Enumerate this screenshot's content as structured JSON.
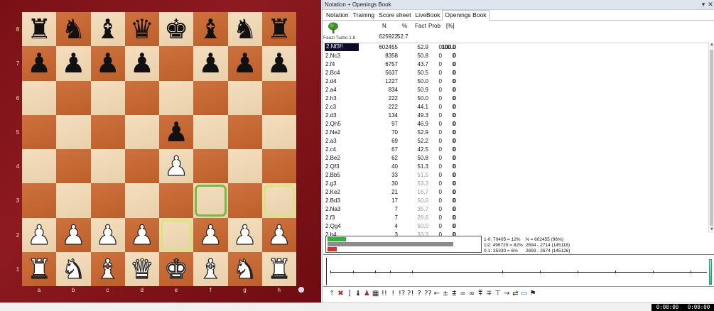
{
  "board": {
    "files": [
      "a",
      "b",
      "c",
      "d",
      "e",
      "f",
      "g",
      "h"
    ],
    "ranks": [
      "8",
      "7",
      "6",
      "5",
      "4",
      "3",
      "2",
      "1"
    ],
    "position": [
      [
        "br",
        "bn",
        "bb",
        "bq",
        "bk",
        "bb",
        "bn",
        "br"
      ],
      [
        "bp",
        "bp",
        "bp",
        "bp",
        "",
        "bp",
        "bp",
        "bp"
      ],
      [
        "",
        "",
        "",
        "",
        "",
        "",
        "",
        ""
      ],
      [
        "",
        "",
        "",
        "",
        "bp",
        "",
        "",
        ""
      ],
      [
        "",
        "",
        "",
        "",
        "wp",
        "",
        "",
        ""
      ],
      [
        "",
        "",
        "",
        "",
        "",
        "",
        "",
        ""
      ],
      [
        "wp",
        "wp",
        "wp",
        "wp",
        "",
        "wp",
        "wp",
        "wp"
      ],
      [
        "wr",
        "wn",
        "wb",
        "wq",
        "wk",
        "wb",
        "wn",
        "wr"
      ]
    ],
    "highlights": [
      {
        "square": "f3",
        "color": "green"
      },
      {
        "square": "h3",
        "color": "yellow"
      },
      {
        "square": "e2",
        "color": "yellow"
      }
    ]
  },
  "window": {
    "title": "Notation + Openings Book",
    "pin_icon": "pin-icon",
    "close_icon": "close-icon"
  },
  "tabs": [
    {
      "label": "Notation",
      "active": false
    },
    {
      "label": "Training",
      "active": false
    },
    {
      "label": "Score sheet",
      "active": false
    },
    {
      "label": "LiveBook",
      "active": false
    },
    {
      "label": "Openings Book",
      "active": true
    }
  ],
  "book": {
    "engine": "Fauzi Turbo 1.8",
    "headers": {
      "n": "N",
      "pct": "%",
      "fact": "Fact",
      "prob": "Prob",
      "pcnt": "[%]"
    },
    "totals": {
      "n": "625922",
      "pct": "52.7"
    },
    "moves": [
      {
        "move": "2.Nf3!!",
        "n": "602455",
        "pct": "52.9",
        "fact": "0",
        "prob": "100.0",
        "pcnt": "100.0",
        "selected": true,
        "faint": false
      },
      {
        "move": "2.Nc3",
        "n": "8358",
        "pct": "50.8",
        "fact": "0",
        "prob": "0",
        "pcnt": "0",
        "faint": false
      },
      {
        "move": "2.f4",
        "n": "6757",
        "pct": "43.7",
        "fact": "0",
        "prob": "0",
        "pcnt": "0",
        "faint": false
      },
      {
        "move": "2.Bc4",
        "n": "5637",
        "pct": "50.5",
        "fact": "0",
        "prob": "0",
        "pcnt": "0",
        "faint": false
      },
      {
        "move": "2.d4",
        "n": "1227",
        "pct": "50.0",
        "fact": "0",
        "prob": "0",
        "pcnt": "0",
        "faint": false
      },
      {
        "move": "2.a4",
        "n": "834",
        "pct": "50.9",
        "fact": "0",
        "prob": "0",
        "pcnt": "0",
        "faint": false
      },
      {
        "move": "2.h3",
        "n": "222",
        "pct": "50.0",
        "fact": "0",
        "prob": "0",
        "pcnt": "0",
        "faint": false
      },
      {
        "move": "2.c3",
        "n": "222",
        "pct": "44.1",
        "fact": "0",
        "prob": "0",
        "pcnt": "0",
        "faint": false
      },
      {
        "move": "2.d3",
        "n": "134",
        "pct": "49.3",
        "fact": "0",
        "prob": "0",
        "pcnt": "0",
        "faint": false
      },
      {
        "move": "2.Qh5",
        "n": "97",
        "pct": "46.9",
        "fact": "0",
        "prob": "0",
        "pcnt": "0",
        "faint": false
      },
      {
        "move": "2.Ne2",
        "n": "70",
        "pct": "52.9",
        "fact": "0",
        "prob": "0",
        "pcnt": "0",
        "faint": false
      },
      {
        "move": "2.a3",
        "n": "69",
        "pct": "52.2",
        "fact": "0",
        "prob": "0",
        "pcnt": "0",
        "faint": false
      },
      {
        "move": "2.c4",
        "n": "67",
        "pct": "42.5",
        "fact": "0",
        "prob": "0",
        "pcnt": "0",
        "faint": false
      },
      {
        "move": "2.Be2",
        "n": "62",
        "pct": "50.8",
        "fact": "0",
        "prob": "0",
        "pcnt": "0",
        "faint": false
      },
      {
        "move": "2.Qf3",
        "n": "40",
        "pct": "51.3",
        "fact": "0",
        "prob": "0",
        "pcnt": "0",
        "faint": false
      },
      {
        "move": "2.Bb5",
        "n": "33",
        "pct": "51.5",
        "fact": "0",
        "prob": "0",
        "pcnt": "0",
        "faint": true
      },
      {
        "move": "2.g3",
        "n": "30",
        "pct": "53.3",
        "fact": "0",
        "prob": "0",
        "pcnt": "0",
        "faint": true
      },
      {
        "move": "2.Ke2",
        "n": "21",
        "pct": "16.7",
        "fact": "0",
        "prob": "0",
        "pcnt": "0",
        "faint": true
      },
      {
        "move": "2.Bd3",
        "n": "17",
        "pct": "50.0",
        "fact": "0",
        "prob": "0",
        "pcnt": "0",
        "faint": true
      },
      {
        "move": "2.Na3",
        "n": "7",
        "pct": "35.7",
        "fact": "0",
        "prob": "0",
        "pcnt": "0",
        "faint": true
      },
      {
        "move": "2.f3",
        "n": "7",
        "pct": "28.6",
        "fact": "0",
        "prob": "0",
        "pcnt": "0",
        "faint": true
      },
      {
        "move": "2.Qg4",
        "n": "4",
        "pct": "50.0",
        "fact": "0",
        "prob": "0",
        "pcnt": "0",
        "faint": true
      },
      {
        "move": "2.b4",
        "n": "3",
        "pct": "33.3",
        "fact": "0",
        "prob": "0",
        "pcnt": "0",
        "faint": true
      }
    ]
  },
  "stats": {
    "bars": [
      {
        "name": "white-wins-bar",
        "fraction": 0.12,
        "color": "#2fb43a"
      },
      {
        "name": "draw-bar",
        "fraction": 0.82,
        "color": "#8c8c8c"
      },
      {
        "name": "black-wins-bar",
        "fraction": 0.06,
        "color": "#d13131"
      }
    ],
    "line1": "1-0:  70405 = 12%",
    "line2": "1/2:  496720 = 82%",
    "line3": "0-1:  35330 = 6%",
    "col2_line1": "N = 602455 (96%)",
    "col2_line2": "2694 - 2714 (145118)",
    "col2_line3": "2693 - 2674 (145126)"
  },
  "graph": {
    "ticks": [
      "1",
      "2",
      "3",
      "4",
      "5",
      "10",
      "15",
      "20",
      "25",
      "30",
      "35"
    ]
  },
  "toolbar": [
    {
      "name": "arrow-up-icon",
      "glyph": "↑",
      "cls": "green"
    },
    {
      "name": "delete-variation-icon",
      "glyph": "✖",
      "cls": "red"
    },
    {
      "name": "bracket-icon",
      "glyph": "]",
      "cls": ""
    },
    {
      "name": "piece-black-icon",
      "glyph": "♝",
      "cls": ""
    },
    {
      "name": "piece-red-icon",
      "glyph": "♟",
      "cls": "red"
    },
    {
      "name": "board-icon",
      "glyph": "▦",
      "cls": ""
    },
    {
      "name": "annotation-brilliant",
      "glyph": "!!",
      "cls": ""
    },
    {
      "name": "annotation-good",
      "glyph": "!",
      "cls": ""
    },
    {
      "name": "annotation-interesting",
      "glyph": "!?",
      "cls": ""
    },
    {
      "name": "annotation-dubious",
      "glyph": "?!",
      "cls": ""
    },
    {
      "name": "annotation-mistake",
      "glyph": "?",
      "cls": ""
    },
    {
      "name": "annotation-blunder",
      "glyph": "??",
      "cls": ""
    },
    {
      "name": "eval-arrow-left",
      "glyph": "←",
      "cls": ""
    },
    {
      "name": "eval-plus-minus",
      "glyph": "±",
      "cls": ""
    },
    {
      "name": "eval-slight-plus",
      "glyph": "⩲",
      "cls": ""
    },
    {
      "name": "eval-equal",
      "glyph": "=",
      "cls": ""
    },
    {
      "name": "eval-unclear",
      "glyph": "∞",
      "cls": ""
    },
    {
      "name": "eval-compensation",
      "glyph": "⩱",
      "cls": ""
    },
    {
      "name": "eval-minus-plus",
      "glyph": "∓",
      "cls": ""
    },
    {
      "name": "eval-black-slight",
      "glyph": "⊤",
      "cls": ""
    },
    {
      "name": "eval-arrow-right",
      "glyph": "→",
      "cls": ""
    },
    {
      "name": "eval-initiative",
      "glyph": "⇄",
      "cls": ""
    },
    {
      "name": "eraser-icon",
      "glyph": "▭",
      "cls": "blue"
    },
    {
      "name": "flag-icon",
      "glyph": "⚑",
      "cls": ""
    }
  ],
  "clocks": {
    "white": "0:00:00",
    "black": "0:00:00"
  }
}
